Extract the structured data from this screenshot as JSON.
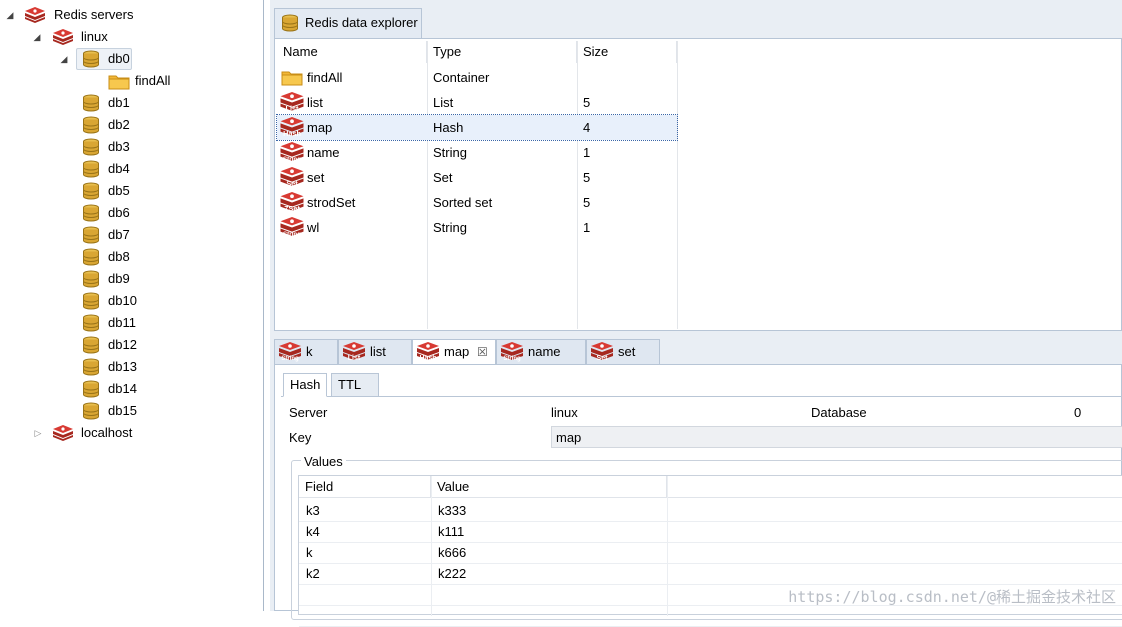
{
  "tree": {
    "root": "Redis servers",
    "server1": "linux",
    "selected_db": "db0",
    "folder": "findAll",
    "dbs": [
      "db1",
      "db2",
      "db3",
      "db4",
      "db5",
      "db6",
      "db7",
      "db8",
      "db9",
      "db10",
      "db11",
      "db12",
      "db13",
      "db14",
      "db15"
    ],
    "server2": "localhost"
  },
  "explorer": {
    "tab_title": "Redis data explorer",
    "columns": [
      "Name",
      "Type",
      "Size"
    ],
    "rows": [
      {
        "icon": "folder",
        "badge": "",
        "name": "findAll",
        "type": "Container",
        "size": ""
      },
      {
        "icon": "redis",
        "badge": "List",
        "name": "list",
        "type": "List",
        "size": "5"
      },
      {
        "icon": "redis",
        "badge": "Hash",
        "name": "map",
        "type": "Hash",
        "size": "4"
      },
      {
        "icon": "redis",
        "badge": "String",
        "name": "name",
        "type": "String",
        "size": "1"
      },
      {
        "icon": "redis",
        "badge": "Set",
        "name": "set",
        "type": "Set",
        "size": "5"
      },
      {
        "icon": "redis",
        "badge": "ZSet",
        "name": "strodSet",
        "type": "Sorted set",
        "size": "5"
      },
      {
        "icon": "redis",
        "badge": "String",
        "name": "wl",
        "type": "String",
        "size": "1"
      }
    ]
  },
  "bottom_tabs": [
    {
      "badge": "String",
      "label": "k"
    },
    {
      "badge": "List",
      "label": "list"
    },
    {
      "badge": "Hash",
      "label": "map",
      "close": "☒"
    },
    {
      "badge": "String",
      "label": "name"
    },
    {
      "badge": "Set",
      "label": "set"
    }
  ],
  "detail": {
    "tabs": [
      "Hash",
      "TTL"
    ],
    "server_label": "Server",
    "server_value": "linux",
    "database_label": "Database",
    "database_value": "0",
    "key_label": "Key",
    "key_value": "map",
    "values_title": "Values",
    "columns": [
      "Field",
      "Value"
    ],
    "rows": [
      {
        "field": "k3",
        "value": "k333"
      },
      {
        "field": "k4",
        "value": "k111"
      },
      {
        "field": "k",
        "value": "k666"
      },
      {
        "field": "k2",
        "value": "k222"
      }
    ]
  },
  "watermark": "https://blog.csdn.net/@稀土掘金技术社区",
  "colors": {
    "redis_red": "#c6302b",
    "db_gold": "#d9a633",
    "folder": "#f2b737",
    "selection": "#e8f0fb"
  }
}
